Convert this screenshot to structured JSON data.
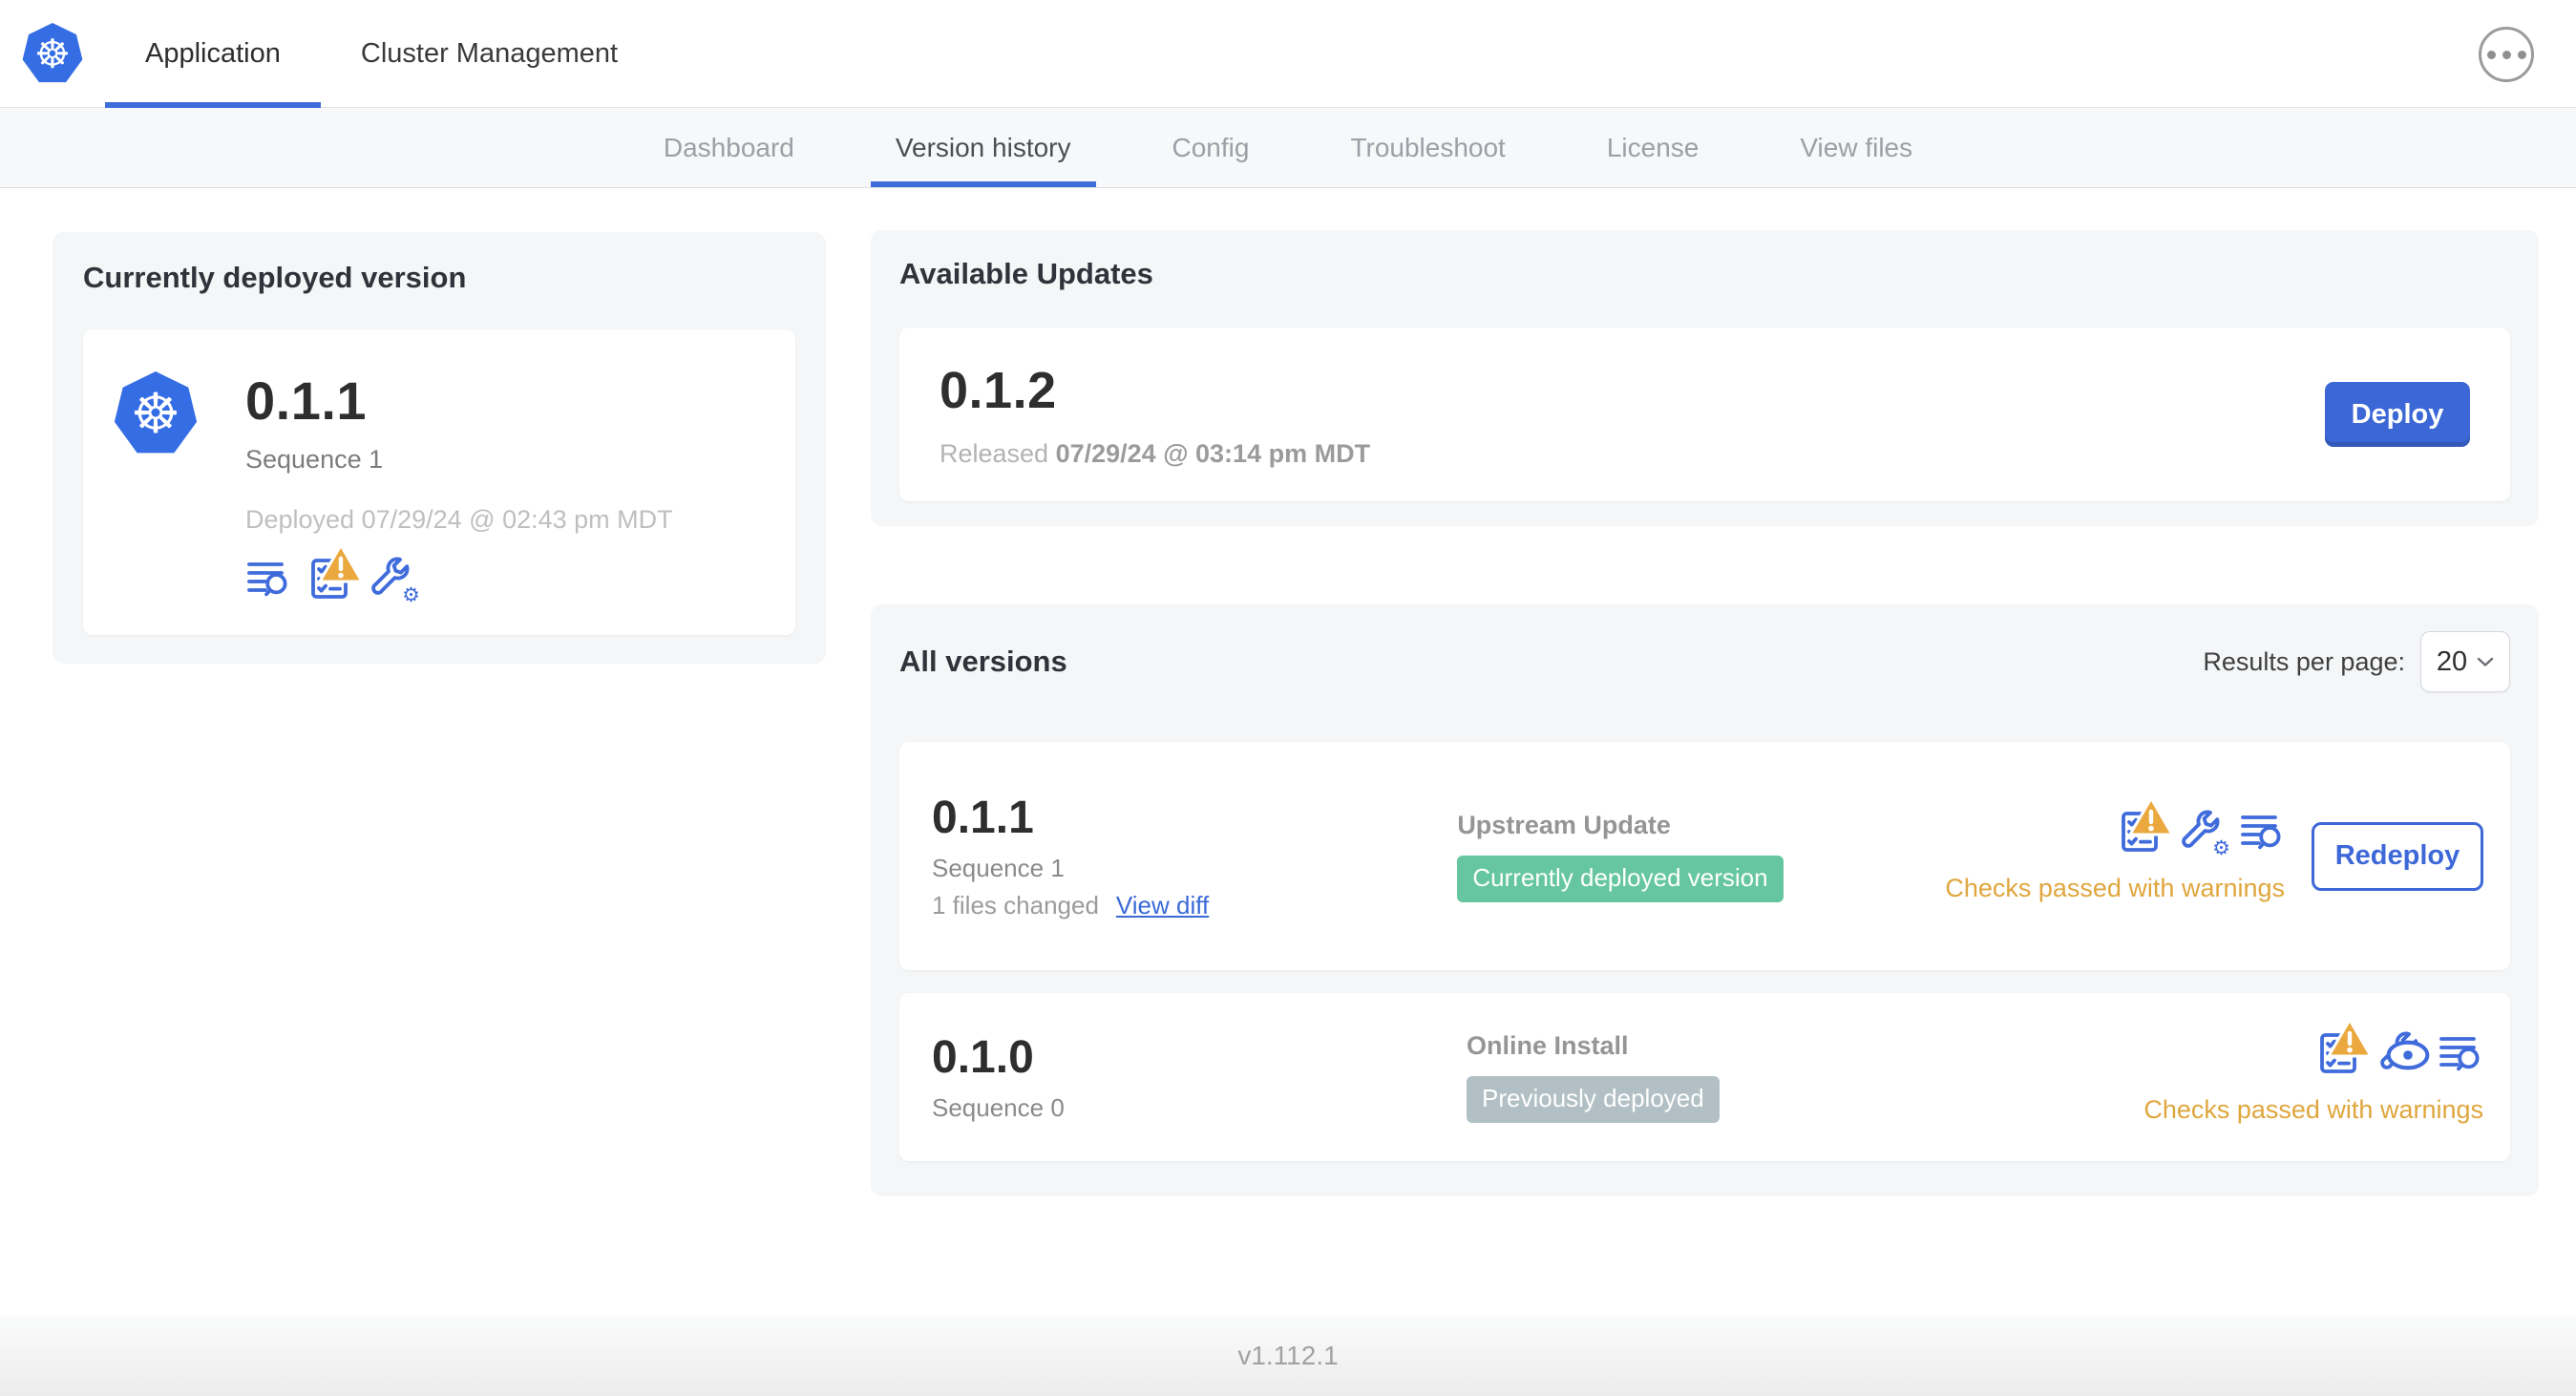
{
  "header": {
    "tabs": [
      {
        "label": "Application",
        "active": true
      },
      {
        "label": "Cluster Management",
        "active": false
      }
    ]
  },
  "subnav": {
    "tabs": [
      {
        "label": "Dashboard",
        "active": false
      },
      {
        "label": "Version history",
        "active": true
      },
      {
        "label": "Config",
        "active": false
      },
      {
        "label": "Troubleshoot",
        "active": false
      },
      {
        "label": "License",
        "active": false
      },
      {
        "label": "View files",
        "active": false
      }
    ]
  },
  "current": {
    "title": "Currently deployed version",
    "version": "0.1.1",
    "sequence": "Sequence 1",
    "deployed": "Deployed 07/29/24 @ 02:43 pm MDT"
  },
  "updates": {
    "title": "Available Updates",
    "version": "0.1.2",
    "released_prefix": "Released",
    "released_date": "07/29/24 @ 03:14 pm MDT",
    "deploy_label": "Deploy"
  },
  "versions": {
    "title": "All versions",
    "results_label": "Results per page:",
    "results_value": "20",
    "rows": [
      {
        "version": "0.1.1",
        "sequence": "Sequence 1",
        "files_changed": "1 files changed",
        "view_diff": "View diff",
        "source": "Upstream Update",
        "badge": "Currently deployed version",
        "status": "Checks passed with warnings",
        "action": "Redeploy"
      },
      {
        "version": "0.1.0",
        "sequence": "Sequence 0",
        "source": "Online Install",
        "badge": "Previously deployed",
        "status": "Checks passed with warnings"
      }
    ]
  },
  "footer": {
    "app_version": "v1.112.1"
  },
  "colors": {
    "accent_blue": "#3c67d6",
    "nav_underline_blue": "#3f6bdb",
    "warning_amber": "#dfa63d",
    "badge_green": "#65c6a1",
    "badge_gray": "#b2c0c5",
    "k8s_blue": "#356de4"
  }
}
